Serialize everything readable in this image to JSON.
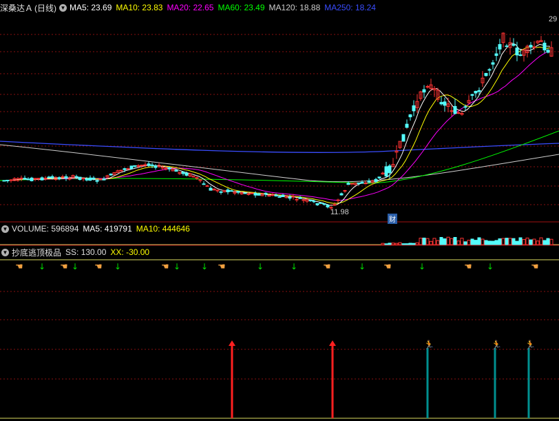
{
  "main_panel": {
    "stock_name": "深桑达Ａ",
    "period": "(日线)",
    "ma_legend": [
      {
        "label": "MA5: 23.69",
        "color": "#ffffff"
      },
      {
        "label": "MA10: 23.83",
        "color": "#ffff00"
      },
      {
        "label": "MA20: 22.65",
        "color": "#ff00ff"
      },
      {
        "label": "MA60: 23.49",
        "color": "#00ff00"
      },
      {
        "label": "MA120: 18.88",
        "color": "#cfcfcf"
      },
      {
        "label": "MA250: 18.24",
        "color": "#3a4dff"
      }
    ],
    "high_label": "29",
    "low_label": "11.98",
    "finance_badge": "财"
  },
  "volume_panel": {
    "title": "VOLUME: 596894",
    "ma5": "MA5: 419791",
    "ma10": "MA10: 444646",
    "ma5_color": "#ffffff",
    "ma10_color": "#ffff00"
  },
  "indicator_panel": {
    "title": "抄底逃顶极品",
    "ss": "SS: 130.00",
    "xx": "XX: -30.00",
    "xx_color": "#ffff00"
  },
  "chart_data": {
    "type": "candlestick",
    "price_high": 29,
    "price_low": 11.98,
    "volume": 596894,
    "indicator_signals": [
      {
        "type": "red-arrow"
      },
      {
        "type": "red-arrow"
      },
      {
        "type": "runner"
      },
      {
        "type": "runner"
      },
      {
        "type": "runner"
      }
    ]
  },
  "colors": {
    "up": "#ff3333",
    "down": "#54fcfc",
    "grid": "#8a1010",
    "ma_white": "#ffffff",
    "ma_yellow": "#ffff00",
    "ma_magenta": "#ff00ff",
    "ma_green": "#00ff00",
    "ma_gray": "#cfcfcf",
    "ma_blue": "#3a4dff",
    "teal_bar": "#009090",
    "hand": "#f0a040",
    "green_arrow": "#00e000"
  }
}
